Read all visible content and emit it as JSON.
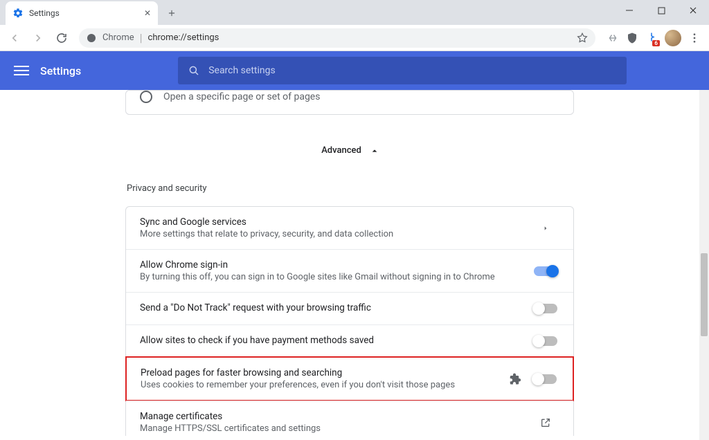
{
  "tab": {
    "title": "Settings"
  },
  "omnibox": {
    "origin_label": "Chrome",
    "url": "chrome://settings"
  },
  "header": {
    "title": "Settings",
    "search_placeholder": "Search settings"
  },
  "startup": {
    "open_option": "Open a specific page or set of pages"
  },
  "advanced_label": "Advanced",
  "section": {
    "title": "Privacy and security"
  },
  "rows": {
    "sync": {
      "title": "Sync and Google services",
      "sub": "More settings that relate to privacy, security, and data collection"
    },
    "signin": {
      "title": "Allow Chrome sign-in",
      "sub": "By turning this off, you can sign in to Google sites like Gmail without signing in to Chrome",
      "on": true
    },
    "dnt": {
      "title": "Send a \"Do Not Track\" request with your browsing traffic",
      "on": false
    },
    "payment": {
      "title": "Allow sites to check if you have payment methods saved",
      "on": false
    },
    "preload": {
      "title": "Preload pages for faster browsing and searching",
      "sub": "Uses cookies to remember your preferences, even if you don't visit those pages",
      "on": false
    },
    "certs": {
      "title": "Manage certificates",
      "sub": "Manage HTTPS/SSL certificates and settings"
    }
  }
}
